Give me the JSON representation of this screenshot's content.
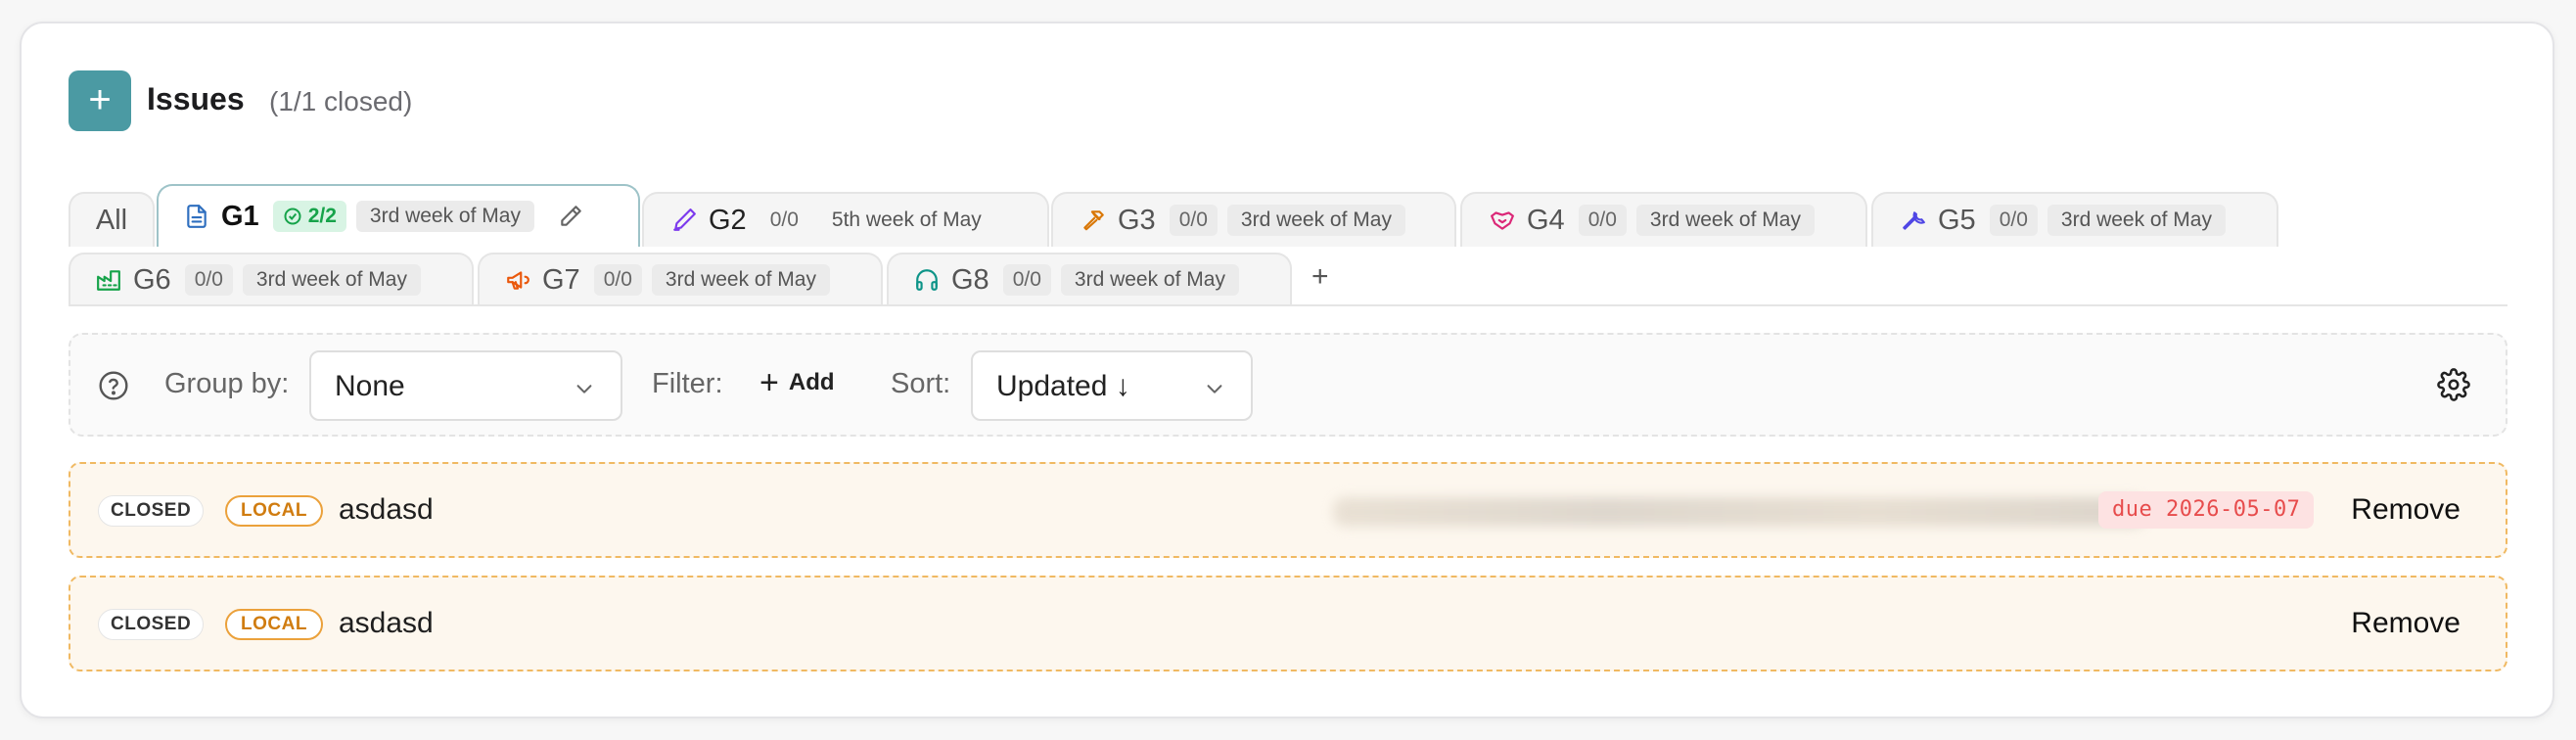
{
  "header": {
    "title": "Issues",
    "subtitle": "(1/1 closed)",
    "add_icon": "plus-icon",
    "add_label": "+"
  },
  "tabs": [
    {
      "name": "All"
    },
    {
      "name": "G1",
      "icon": "document-icon",
      "icon_color": "#2f6fbf",
      "count": "2/2",
      "week": "3rd week of May",
      "active": true,
      "edit_icon": "pencil-icon"
    },
    {
      "name": "G2",
      "icon": "pen-icon",
      "icon_color": "#7c3aed",
      "count": "0/0",
      "week": "5th week of May"
    },
    {
      "name": "G3",
      "icon": "hammer-icon",
      "icon_color": "#d97706",
      "count": "0/0",
      "week": "3rd week of May"
    },
    {
      "name": "G4",
      "icon": "handshake-icon",
      "icon_color": "#db2777",
      "count": "0/0",
      "week": "3rd week of May"
    },
    {
      "name": "G5",
      "icon": "wrench-icon",
      "icon_color": "#4f46e5",
      "count": "0/0",
      "week": "3rd week of May"
    },
    {
      "name": "G6",
      "icon": "factory-icon",
      "icon_color": "#16a34a",
      "count": "0/0",
      "week": "3rd week of May"
    },
    {
      "name": "G7",
      "icon": "megaphone-icon",
      "icon_color": "#ea580c",
      "count": "0/0",
      "week": "3rd week of May"
    },
    {
      "name": "G8",
      "icon": "headphones-icon",
      "icon_color": "#0d9488",
      "count": "0/0",
      "week": "3rd week of May"
    }
  ],
  "add_tab_label": "+",
  "toolbar": {
    "help_icon": "question-circle-icon",
    "group_by_label": "Group by:",
    "group_by_value": "None",
    "filter_label": "Filter:",
    "filter_add_label": "Add",
    "sort_label": "Sort:",
    "sort_value": "Updated ↓",
    "settings_icon": "gear-icon"
  },
  "issues": [
    {
      "status": "CLOSED",
      "source": "LOCAL",
      "title": "asdasd",
      "due": "due 2026-05-07",
      "action": "Remove"
    },
    {
      "status": "CLOSED",
      "source": "LOCAL",
      "title": "asdasd",
      "action": "Remove"
    }
  ]
}
